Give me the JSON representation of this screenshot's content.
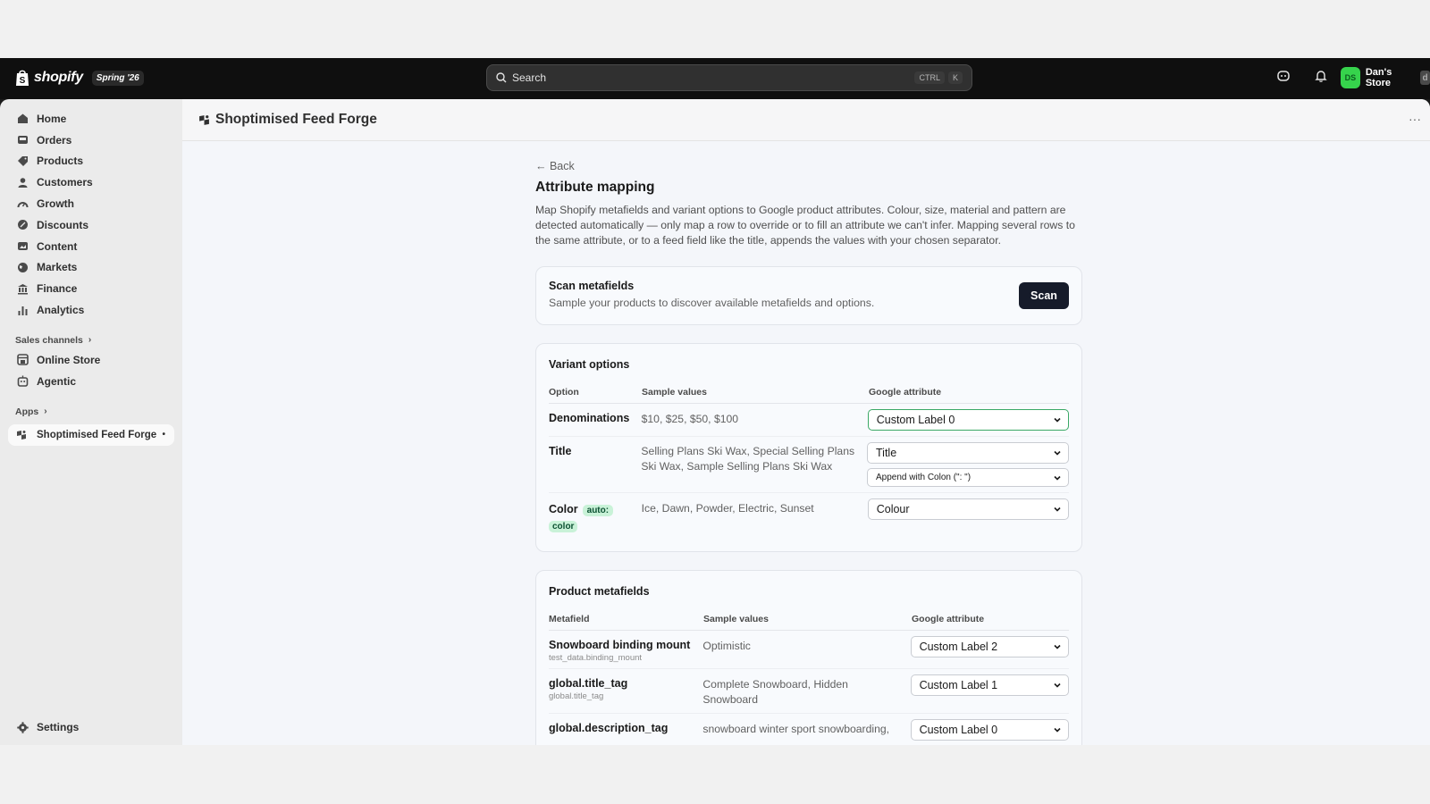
{
  "topbar": {
    "brand": "shopify",
    "edition": "Spring '26",
    "search_placeholder": "Search",
    "shortcut_key1": "CTRL",
    "shortcut_key2": "K",
    "store_initials": "DS",
    "store_name": "Dan's Store",
    "store_tail": "d"
  },
  "sidebar": {
    "items": [
      {
        "label": "Home",
        "icon": "home-icon"
      },
      {
        "label": "Orders",
        "icon": "inbox-icon"
      },
      {
        "label": "Products",
        "icon": "tag-icon"
      },
      {
        "label": "Customers",
        "icon": "person-icon"
      },
      {
        "label": "Growth",
        "icon": "gauge-icon"
      },
      {
        "label": "Discounts",
        "icon": "discount-icon"
      },
      {
        "label": "Content",
        "icon": "image-icon"
      },
      {
        "label": "Markets",
        "icon": "globe-icon"
      },
      {
        "label": "Finance",
        "icon": "bank-icon"
      },
      {
        "label": "Analytics",
        "icon": "bar-chart-icon"
      }
    ],
    "sales_channels_label": "Sales channels",
    "channels": [
      {
        "label": "Online Store",
        "icon": "store-icon"
      },
      {
        "label": "Agentic",
        "icon": "robot-icon"
      }
    ],
    "apps_label": "Apps",
    "active_app": "Shoptimised Feed Forge",
    "active_app_dot": "•",
    "settings_label": "Settings"
  },
  "app_header": {
    "title": "Shoptimised Feed Forge",
    "more": "···"
  },
  "page": {
    "back": "← Back",
    "title": "Attribute mapping",
    "description": "Map Shopify metafields and variant options to Google product attributes. Colour, size, material and pattern are detected automatically — only map a row to override or to fill an attribute we can't infer. Mapping several rows to the same attribute, or to a feed field like the title, appends the values with your chosen separator."
  },
  "scan": {
    "title": "Scan metafields",
    "subtitle": "Sample your products to discover available metafields and options.",
    "button": "Scan"
  },
  "variant_options": {
    "title": "Variant options",
    "headers": {
      "option": "Option",
      "sample": "Sample values",
      "google": "Google attribute"
    },
    "rows": [
      {
        "name": "Denominations",
        "values": "$10, $25, $50, $100",
        "select": "Custom Label 0"
      },
      {
        "name": "Title",
        "values": "Selling Plans Ski Wax, Special Selling Plans Ski Wax, Sample Selling Plans Ski Wax",
        "select": "Title",
        "separator": "Append with Colon (\": \")"
      },
      {
        "name": "Color",
        "badge_a": "auto:",
        "badge_b": "color",
        "values": "Ice, Dawn, Powder, Electric, Sunset",
        "select": "Colour"
      }
    ]
  },
  "product_metafields": {
    "title": "Product metafields",
    "headers": {
      "metafield": "Metafield",
      "sample": "Sample values",
      "google": "Google attribute"
    },
    "rows": [
      {
        "name": "Snowboard binding mount",
        "key": "test_data.binding_mount",
        "values": "Optimistic",
        "select": "Custom Label 2"
      },
      {
        "name": "global.title_tag",
        "key": "global.title_tag",
        "values": "Complete Snowboard, Hidden Snowboard",
        "select": "Custom Label 1"
      },
      {
        "name": "global.description_tag",
        "key": "",
        "values": "snowboard winter sport snowboarding,",
        "select": "Custom Label 0"
      }
    ]
  }
}
